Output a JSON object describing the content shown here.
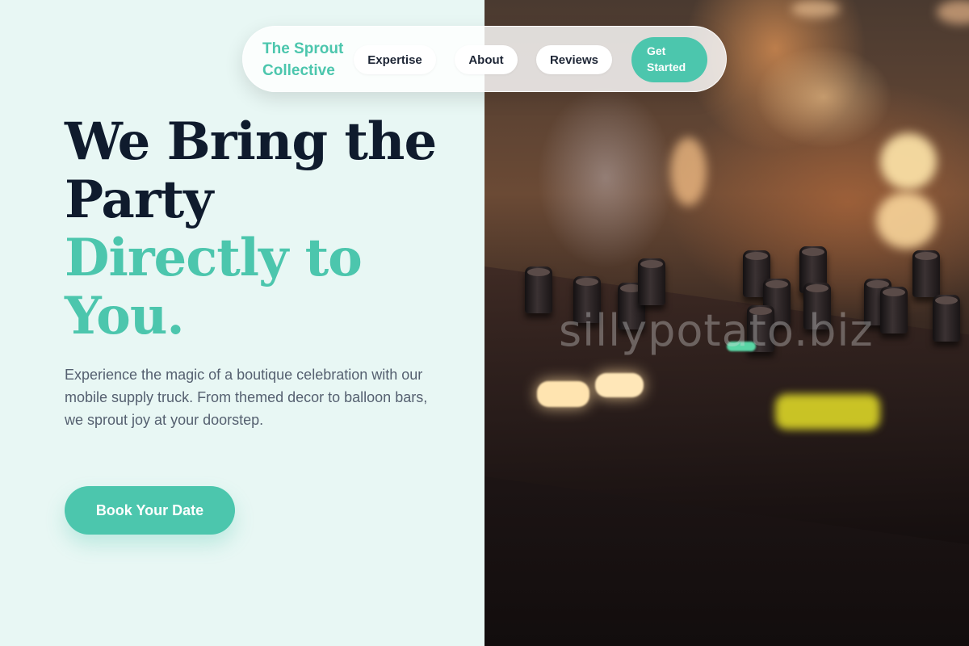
{
  "nav": {
    "brand": "The Sprout Collective",
    "links": [
      {
        "label": "Expertise"
      },
      {
        "label": "About"
      },
      {
        "label": "Reviews"
      }
    ],
    "cta_label": "Get Started"
  },
  "hero": {
    "title_line_dark": "We Bring the Party",
    "title_line_accent": "Directly to You.",
    "description": "Experience the magic of a boutique celebration with our mobile supply truck. From themed decor to balloon bars, we sprout joy at your doorstep.",
    "cta_label": "Book Your Date"
  },
  "photo": {
    "subject": "DJ mixer with warm bokeh lights",
    "watermark": "sillypotato.biz"
  },
  "colors": {
    "accent": "#4cc6ad",
    "heading": "#0f1b2d",
    "body_text": "#556070",
    "panel_bg": "#e8f7f4"
  }
}
